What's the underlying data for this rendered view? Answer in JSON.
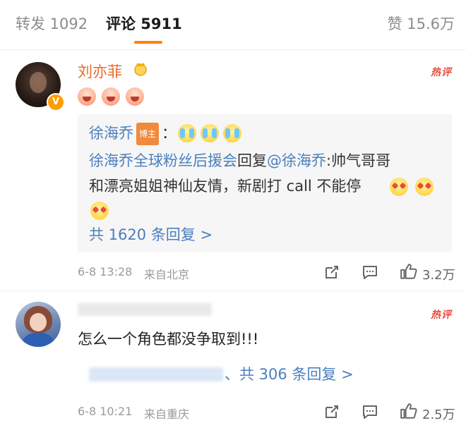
{
  "tabs": {
    "repost": "转发 1092",
    "comments": "评论 5911",
    "likes": "赞 15.6万"
  },
  "colors": {
    "accent": "#ff8200",
    "username": "#e86b2b",
    "link": "#4a7fbf",
    "hot": "#e84c3d"
  },
  "comments": [
    {
      "username": "刘亦菲",
      "hot_label": "热评",
      "reply_preview": {
        "author": "徐海乔",
        "author_tag": "博主",
        "colon": "：",
        "second_line_author": "徐海乔全球粉丝后援会",
        "second_line_text": "回复",
        "mention": "@徐海乔",
        "second_line_rest": ":帅气哥哥",
        "third_line": "和漂亮姐姐神仙友情，新剧打 call 不能停",
        "total_replies": "共 1620 条回复 >"
      },
      "time": "6-8 13:28",
      "source": "来自北京",
      "like_count": "3.2万"
    },
    {
      "hot_label": "热评",
      "text": "怎么一个角色都没争取到!!!",
      "total_replies": "、共 306 条回复 >",
      "time": "6-8 10:21",
      "source": "来自重庆",
      "like_count": "2.5万"
    }
  ]
}
